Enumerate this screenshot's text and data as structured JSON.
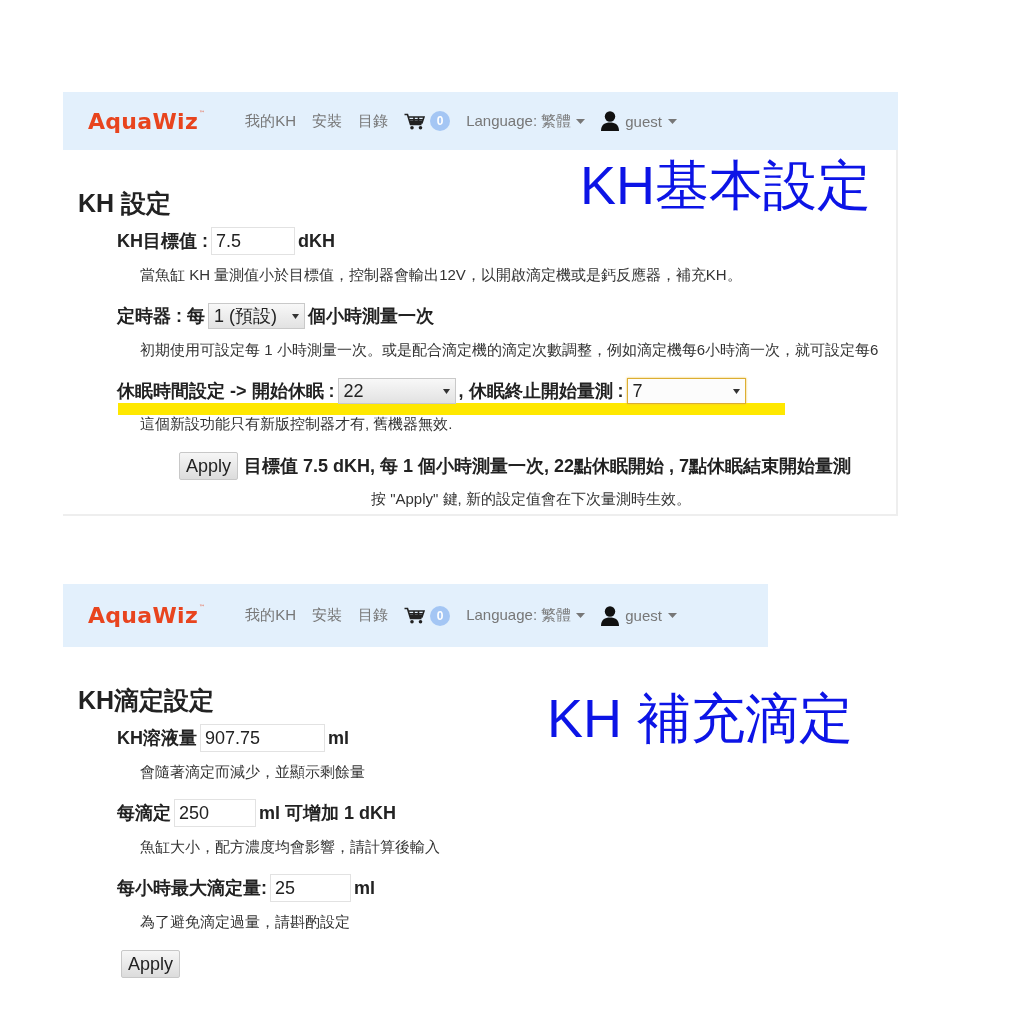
{
  "panels": [
    {
      "navbar": {
        "logo": "AquaWiz$^{™}$",
        "links": [
          "我的KH",
          "安裝",
          "目錄"
        ],
        "cart_count": "0",
        "language": "Language: 繁體",
        "user": "guest"
      },
      "heading": "KH 設定",
      "annotation": "KH基本設定",
      "fields": [
        {
          "highlighted": false,
          "parts": [
            {
              "kind": "label",
              "text": "KH目標值 :"
            },
            {
              "kind": "input",
              "value": "7.5"
            },
            {
              "kind": "label",
              "text": "dKH"
            }
          ],
          "hint": "當魚缸 KH 量測值小於目標值，控制器會輸出12V，以開啟滴定機或是鈣反應器，補充KH。"
        },
        {
          "highlighted": false,
          "parts": [
            {
              "kind": "label",
              "text": "定時器 : 每"
            },
            {
              "kind": "select",
              "value": "1 (預設)",
              "focused": false
            },
            {
              "kind": "label",
              "text": "個小時測量一次"
            }
          ],
          "hint": "初期使用可設定每 1 小時測量一次。或是配合滴定機的滴定次數調整，例如滴定機每6小時滴一次，就可設定每6"
        },
        {
          "highlighted": true,
          "parts": [
            {
              "kind": "label",
              "text": "休眠時間設定 -> 開始休眠 :"
            },
            {
              "kind": "select",
              "value": "22",
              "focused": false
            },
            {
              "kind": "label",
              "text": ", 休眠終止開始量測 :"
            },
            {
              "kind": "select",
              "value": "7",
              "focused": true
            }
          ],
          "hint": "這個新設功能只有新版控制器才有, 舊機器無效."
        }
      ],
      "apply": {
        "button": "Apply",
        "summary": "目標值 7.5 dKH, 每 1 個小時測量一次, 22點休眠開始 , 7點休眠結束開始量測",
        "note": "按 \"Apply\" 鍵, 新的設定值會在下次量測時生效。"
      }
    },
    {
      "navbar": {
        "logo": "AquaWiz$^{™}$",
        "links": [
          "我的KH",
          "安裝",
          "目錄"
        ],
        "cart_count": "0",
        "language": "Language: 繁體",
        "user": "guest"
      },
      "heading": "KH滴定設定",
      "annotation": "KH 補充滴定",
      "fields": [
        {
          "highlighted": false,
          "parts": [
            {
              "kind": "label",
              "text": "KH溶液量"
            },
            {
              "kind": "input",
              "value": "907.75"
            },
            {
              "kind": "label",
              "text": "ml"
            }
          ],
          "hint": "會隨著滴定而減少，並顯示剩餘量"
        },
        {
          "highlighted": false,
          "parts": [
            {
              "kind": "label",
              "text": "每滴定"
            },
            {
              "kind": "input",
              "value": "250"
            },
            {
              "kind": "label",
              "text": "ml 可增加 1 dKH"
            }
          ],
          "hint": "魚缸大小，配方濃度均會影響，請計算後輸入"
        },
        {
          "highlighted": false,
          "parts": [
            {
              "kind": "label",
              "text": "每小時最大滴定量:"
            },
            {
              "kind": "input",
              "value": "25"
            },
            {
              "kind": "label",
              "text": "ml"
            }
          ],
          "hint": "為了避免滴定過量，請斟酌設定"
        }
      ],
      "apply": {
        "button": "Apply"
      }
    }
  ]
}
